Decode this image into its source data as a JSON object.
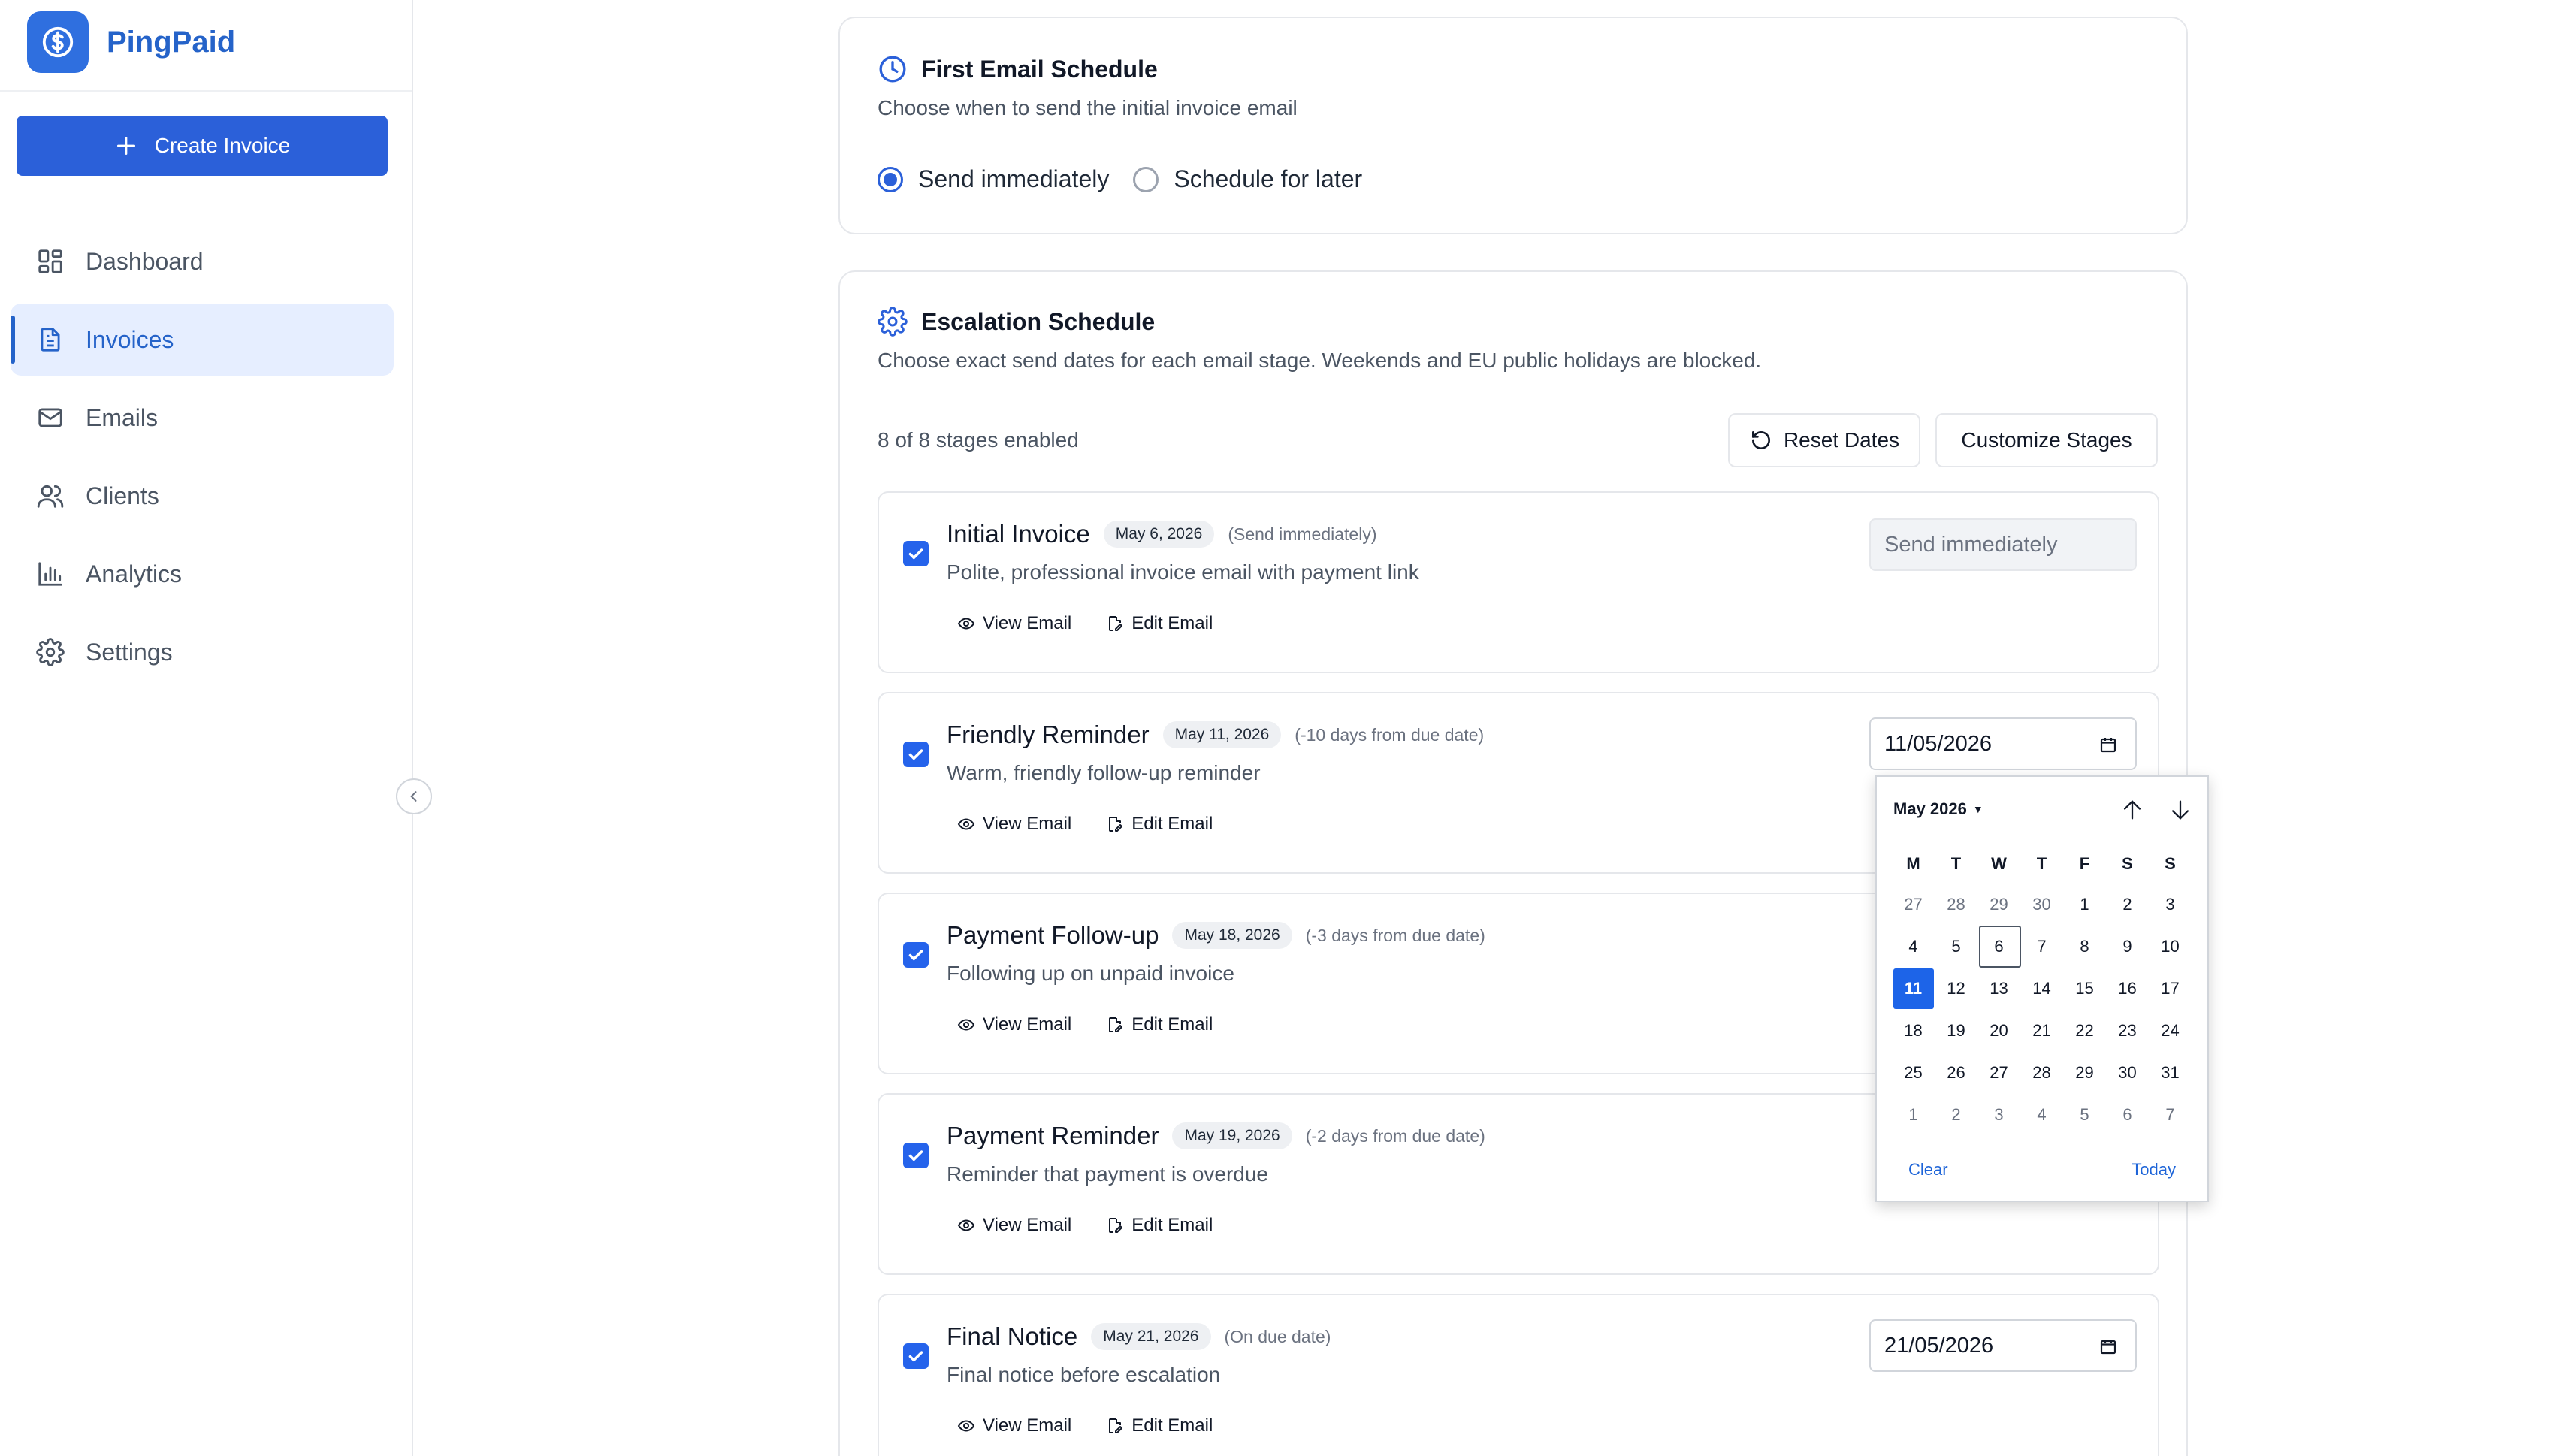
{
  "brand": {
    "name": "PingPaid",
    "logo_icon": "dollar-circle-icon"
  },
  "sidebar": {
    "create_label": "Create Invoice",
    "items": [
      {
        "label": "Dashboard",
        "icon": "dashboard-icon",
        "active": false
      },
      {
        "label": "Invoices",
        "icon": "file-icon",
        "active": true
      },
      {
        "label": "Emails",
        "icon": "mail-icon",
        "active": false
      },
      {
        "label": "Clients",
        "icon": "users-icon",
        "active": false
      },
      {
        "label": "Analytics",
        "icon": "bar-chart-icon",
        "active": false
      },
      {
        "label": "Settings",
        "icon": "gear-icon",
        "active": false
      }
    ]
  },
  "first_email": {
    "title": "First Email Schedule",
    "subtitle": "Choose when to send the initial invoice email",
    "options": [
      {
        "label": "Send immediately",
        "selected": true
      },
      {
        "label": "Schedule for later",
        "selected": false
      }
    ]
  },
  "escalation": {
    "title": "Escalation Schedule",
    "subtitle": "Choose exact send dates for each email stage. Weekends and EU public holidays are blocked.",
    "stages_count": "8 of 8 stages enabled",
    "reset_label": "Reset Dates",
    "customize_label": "Customize Stages",
    "view_label": "View Email",
    "edit_label": "Edit Email",
    "stages": [
      {
        "name": "Initial Invoice",
        "date_badge": "May 6, 2026",
        "offset": "(Send immediately)",
        "desc": "Polite, professional invoice email with payment link",
        "input": "Send immediately",
        "checked": true
      },
      {
        "name": "Friendly Reminder",
        "date_badge": "May 11, 2026",
        "offset": "(-10 days from due date)",
        "desc": "Warm, friendly follow-up reminder",
        "input": "11/05/2026",
        "checked": true
      },
      {
        "name": "Payment Follow-up",
        "date_badge": "May 18, 2026",
        "offset": "(-3 days from due date)",
        "desc": "Following up on unpaid invoice",
        "input": "",
        "checked": true
      },
      {
        "name": "Payment Reminder",
        "date_badge": "May 19, 2026",
        "offset": "(-2 days from due date)",
        "desc": "Reminder that payment is overdue",
        "input": "",
        "checked": true
      },
      {
        "name": "Final Notice",
        "date_badge": "May 21, 2026",
        "offset": "(On due date)",
        "desc": "Final notice before escalation",
        "input": "21/05/2026",
        "checked": true
      }
    ]
  },
  "calendar": {
    "month_label": "May 2026",
    "weekdays": [
      "M",
      "T",
      "W",
      "T",
      "F",
      "S",
      "S"
    ],
    "weeks": [
      [
        {
          "d": "27",
          "m": true
        },
        {
          "d": "28",
          "m": true
        },
        {
          "d": "29",
          "m": true
        },
        {
          "d": "30",
          "m": true
        },
        {
          "d": "1"
        },
        {
          "d": "2"
        },
        {
          "d": "3"
        }
      ],
      [
        {
          "d": "4"
        },
        {
          "d": "5"
        },
        {
          "d": "6",
          "today": true
        },
        {
          "d": "7"
        },
        {
          "d": "8"
        },
        {
          "d": "9"
        },
        {
          "d": "10"
        }
      ],
      [
        {
          "d": "11",
          "sel": true
        },
        {
          "d": "12"
        },
        {
          "d": "13"
        },
        {
          "d": "14"
        },
        {
          "d": "15"
        },
        {
          "d": "16"
        },
        {
          "d": "17"
        }
      ],
      [
        {
          "d": "18"
        },
        {
          "d": "19"
        },
        {
          "d": "20"
        },
        {
          "d": "21"
        },
        {
          "d": "22"
        },
        {
          "d": "23"
        },
        {
          "d": "24"
        }
      ],
      [
        {
          "d": "25"
        },
        {
          "d": "26"
        },
        {
          "d": "27"
        },
        {
          "d": "28"
        },
        {
          "d": "29"
        },
        {
          "d": "30"
        },
        {
          "d": "31"
        }
      ],
      [
        {
          "d": "1",
          "m": true
        },
        {
          "d": "2",
          "m": true
        },
        {
          "d": "3",
          "m": true
        },
        {
          "d": "4",
          "m": true
        },
        {
          "d": "5",
          "m": true
        },
        {
          "d": "6",
          "m": true
        },
        {
          "d": "7",
          "m": true
        }
      ]
    ],
    "clear_label": "Clear",
    "today_label": "Today"
  },
  "colors": {
    "accent": "#2b60d9",
    "brand_text": "#2563c9",
    "active_bg": "#e6eeff"
  }
}
